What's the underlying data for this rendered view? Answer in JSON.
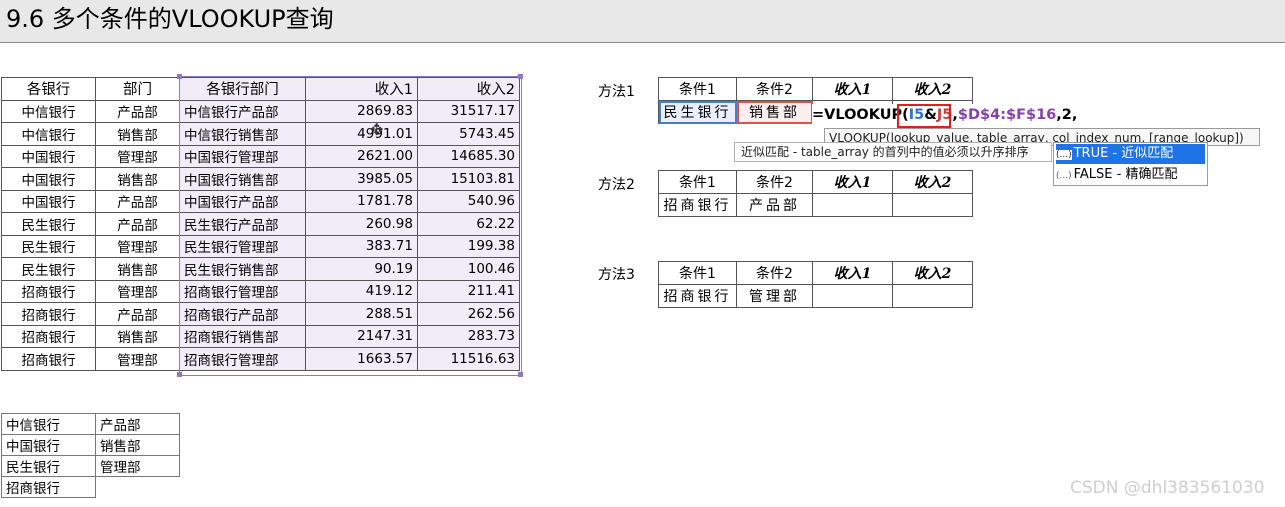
{
  "title": "9.6 多个条件的VLOOKUP查询",
  "main_table": {
    "headers": [
      "各银行",
      "部门",
      "各银行部门",
      "收入1",
      "收入2"
    ],
    "rows": [
      [
        "中信银行",
        "产品部",
        "中信银行产品部",
        "2869.83",
        "31517.17"
      ],
      [
        "中信银行",
        "销售部",
        "中信银行销售部",
        "4991.01",
        "5743.45"
      ],
      [
        "中国银行",
        "管理部",
        "中国银行管理部",
        "2621.00",
        "14685.30"
      ],
      [
        "中国银行",
        "销售部",
        "中国银行销售部",
        "3985.05",
        "15103.81"
      ],
      [
        "中国银行",
        "产品部",
        "中国银行产品部",
        "1781.78",
        "540.96"
      ],
      [
        "民生银行",
        "产品部",
        "民生银行产品部",
        "260.98",
        "62.22"
      ],
      [
        "民生银行",
        "管理部",
        "民生银行管理部",
        "383.71",
        "199.38"
      ],
      [
        "民生银行",
        "销售部",
        "民生银行销售部",
        "90.19",
        "100.46"
      ],
      [
        "招商银行",
        "管理部",
        "招商银行管理部",
        "419.12",
        "211.41"
      ],
      [
        "招商银行",
        "产品部",
        "招商银行产品部",
        "288.51",
        "262.56"
      ],
      [
        "招商银行",
        "销售部",
        "招商银行销售部",
        "2147.31",
        "283.73"
      ],
      [
        "招商银行",
        "管理部",
        "招商银行管理部",
        "1663.57",
        "11516.63"
      ]
    ]
  },
  "small_table": {
    "rows": [
      [
        "中信银行",
        "产品部"
      ],
      [
        "中国银行",
        "销售部"
      ],
      [
        "民生银行",
        "管理部"
      ],
      [
        "招商银行",
        ""
      ]
    ]
  },
  "methods": [
    {
      "label": "方法1",
      "headers": [
        "条件1",
        "条件2",
        "收入1",
        "收入2"
      ],
      "values": [
        "民生银行",
        "销售部",
        "",
        ""
      ]
    },
    {
      "label": "方法2",
      "headers": [
        "条件1",
        "条件2",
        "收入1",
        "收入2"
      ],
      "values": [
        "招商银行",
        "产品部",
        "",
        ""
      ]
    },
    {
      "label": "方法3",
      "headers": [
        "条件1",
        "条件2",
        "收入1",
        "收入2"
      ],
      "values": [
        "招商银行",
        "管理部",
        "",
        ""
      ]
    }
  ],
  "formula": {
    "prefix": "=VLOOKUP(",
    "i5": "I5",
    "amp": "&",
    "j5": "J5",
    "comma1": ",",
    "range": "$D$4:$F$16",
    "tail": ",2,"
  },
  "tooltip": {
    "syntax": "VLOOKUP(lookup_value, table_array, col_index_num, [range_lookup])",
    "description": "近似匹配 - table_array 的首列中的值必须以升序排序"
  },
  "dropdown": {
    "options": [
      "TRUE - 近似匹配",
      "FALSE - 精确匹配"
    ],
    "icon_text": "(...)",
    "selected_index": 0
  },
  "watermark": "CSDN @dhl383561030",
  "colors": {
    "selection": "#8e7bbd",
    "highlight_fill": "#f1ecf8",
    "i5_ref": "#2e6fd0",
    "j5_ref": "#d23b3b",
    "range_ref": "#8a3fb0",
    "dropdown_selected": "#1e73e8"
  }
}
